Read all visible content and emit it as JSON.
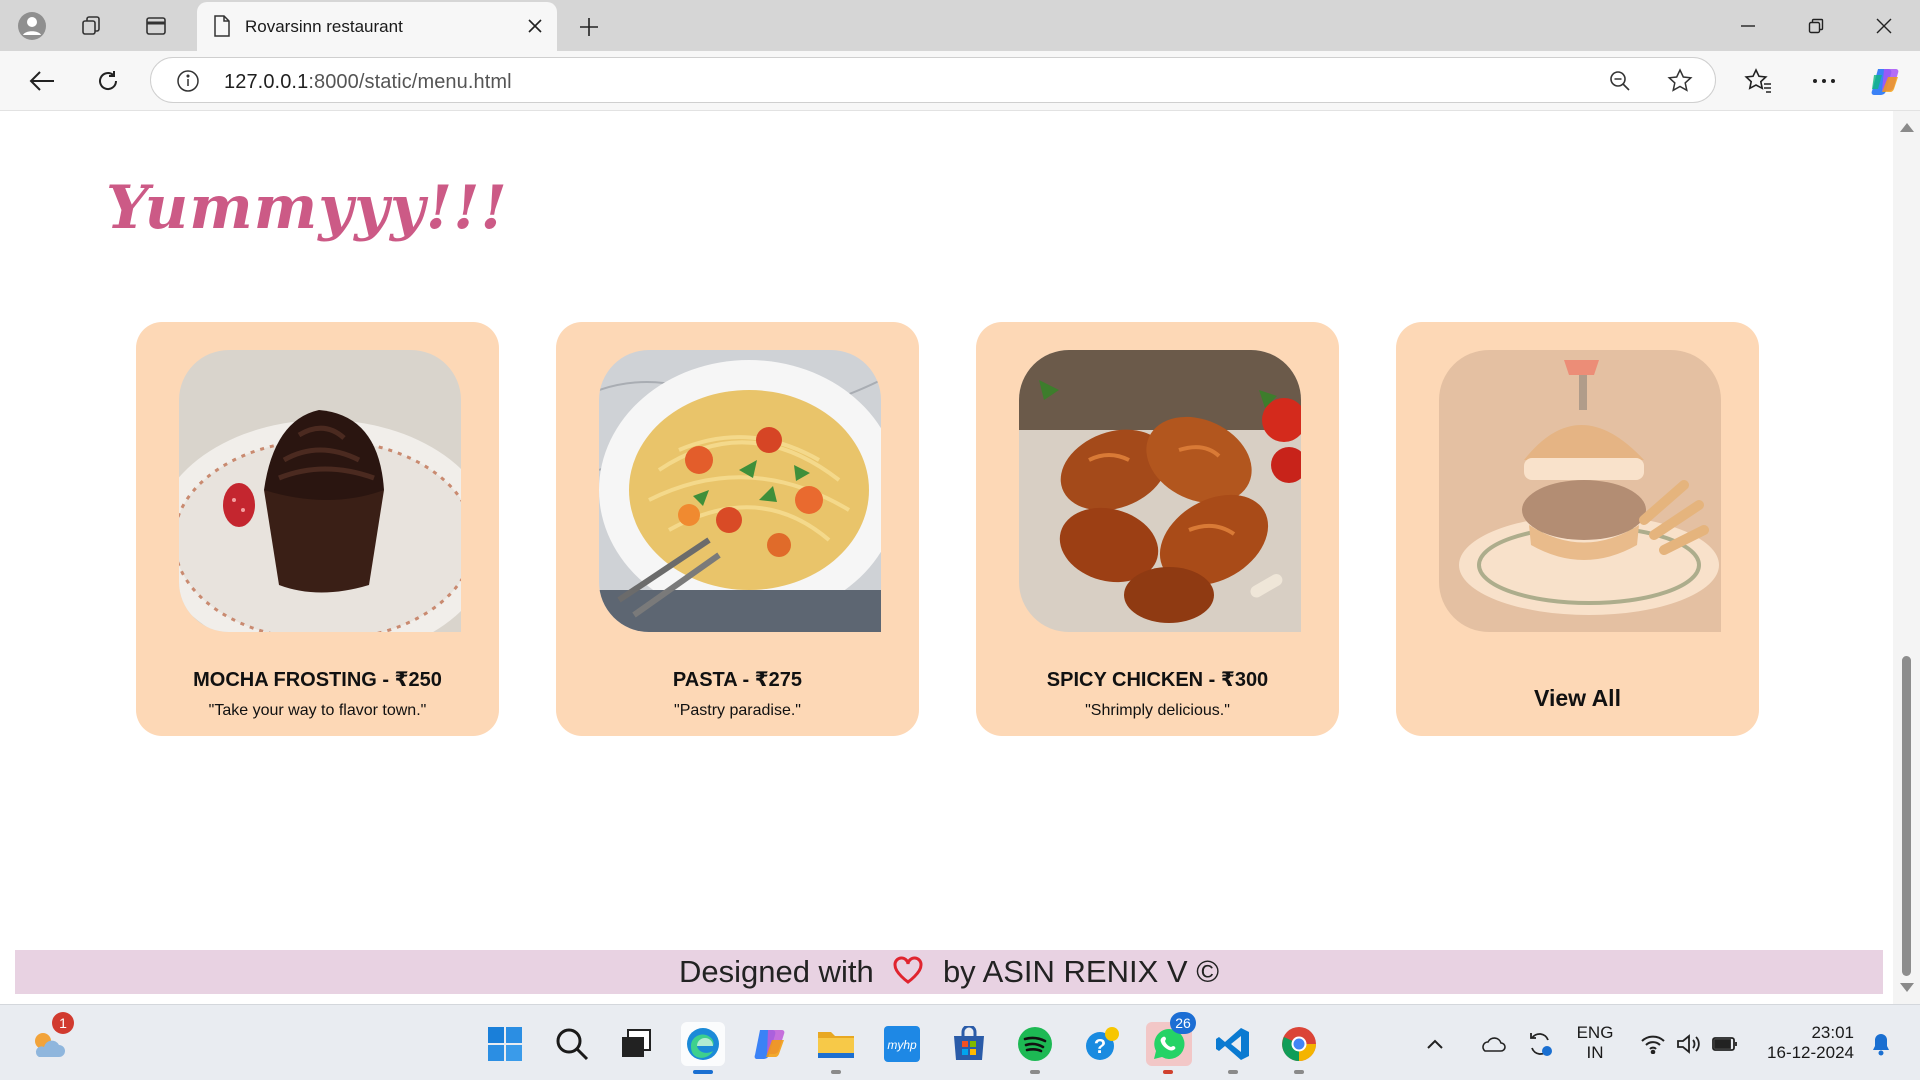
{
  "browser": {
    "tab_title": "Rovarsinn restaurant",
    "url_host": "127.0.0.1",
    "url_rest": ":8000/static/menu.html"
  },
  "page": {
    "heading": "Yummyyy!!!",
    "cards": [
      {
        "title": "MOCHA FROSTING - ₹250",
        "tagline": "\"Take your way to flavor town.\""
      },
      {
        "title": "PASTA - ₹275",
        "tagline": "\"Pastry paradise.\""
      },
      {
        "title": "SPICY CHICKEN - ₹300",
        "tagline": "\"Shrimply delicious.\""
      }
    ],
    "view_all_label": "View All",
    "footer": {
      "before_heart": "Designed with",
      "after_heart": "by ASIN RENIX V ©"
    }
  },
  "taskbar": {
    "weather_badge": "1",
    "whatsapp_badge": "26",
    "language": "ENG",
    "region": "IN",
    "time": "23:01",
    "date": "16-12-2024"
  },
  "colors": {
    "card_bg": "#fdd8b6",
    "heading": "#cc5a86",
    "footer_bg": "#e8d2e2"
  }
}
